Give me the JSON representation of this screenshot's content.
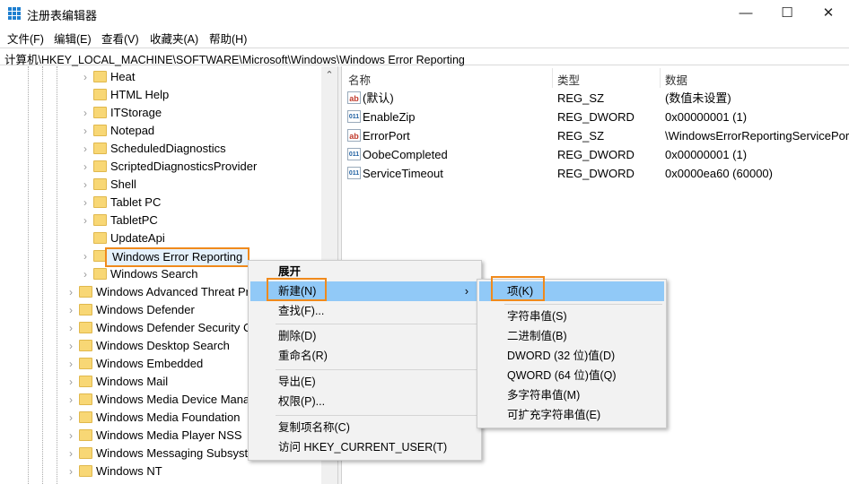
{
  "window": {
    "title": "注册表编辑器",
    "minimize": "—",
    "maximize": "☐",
    "close": "✕"
  },
  "menubar": [
    "文件(F)",
    "编辑(E)",
    "查看(V)",
    "收藏夹(A)",
    "帮助(H)"
  ],
  "address": "计算机\\HKEY_LOCAL_MACHINE\\SOFTWARE\\Microsoft\\Windows\\Windows Error Reporting",
  "tree": [
    {
      "label": "Heat",
      "level": 1,
      "arrow": true
    },
    {
      "label": "HTML Help",
      "level": 1,
      "arrow": false
    },
    {
      "label": "ITStorage",
      "level": 1,
      "arrow": true
    },
    {
      "label": "Notepad",
      "level": 1,
      "arrow": true
    },
    {
      "label": "ScheduledDiagnostics",
      "level": 1,
      "arrow": true
    },
    {
      "label": "ScriptedDiagnosticsProvider",
      "level": 1,
      "arrow": true
    },
    {
      "label": "Shell",
      "level": 1,
      "arrow": true
    },
    {
      "label": "Tablet PC",
      "level": 1,
      "arrow": true
    },
    {
      "label": "TabletPC",
      "level": 1,
      "arrow": true
    },
    {
      "label": "UpdateApi",
      "level": 1,
      "arrow": false
    },
    {
      "label": "Windows Error Reporting",
      "level": 1,
      "arrow": true,
      "selected": true
    },
    {
      "label": "Windows Search",
      "level": 1,
      "arrow": true
    },
    {
      "label": "Windows Advanced Threat Protection",
      "level": 0,
      "arrow": true
    },
    {
      "label": "Windows Defender",
      "level": 0,
      "arrow": true
    },
    {
      "label": "Windows Defender Security Center",
      "level": 0,
      "arrow": true
    },
    {
      "label": "Windows Desktop Search",
      "level": 0,
      "arrow": true
    },
    {
      "label": "Windows Embedded",
      "level": 0,
      "arrow": true
    },
    {
      "label": "Windows Mail",
      "level": 0,
      "arrow": true
    },
    {
      "label": "Windows Media Device Manager",
      "level": 0,
      "arrow": true
    },
    {
      "label": "Windows Media Foundation",
      "level": 0,
      "arrow": true
    },
    {
      "label": "Windows Media Player NSS",
      "level": 0,
      "arrow": true
    },
    {
      "label": "Windows Messaging Subsystem",
      "level": 0,
      "arrow": true
    },
    {
      "label": "Windows NT",
      "level": 0,
      "arrow": true
    }
  ],
  "columns": {
    "name": "名称",
    "type": "类型",
    "data": "数据"
  },
  "values": [
    {
      "icon": "ab",
      "name": "(默认)",
      "type": "REG_SZ",
      "data": "(数值未设置)"
    },
    {
      "icon": "011",
      "name": "EnableZip",
      "type": "REG_DWORD",
      "data": "0x00000001 (1)"
    },
    {
      "icon": "ab",
      "name": "ErrorPort",
      "type": "REG_SZ",
      "data": "\\WindowsErrorReportingServicePort"
    },
    {
      "icon": "011",
      "name": "OobeCompleted",
      "type": "REG_DWORD",
      "data": "0x00000001 (1)"
    },
    {
      "icon": "011",
      "name": "ServiceTimeout",
      "type": "REG_DWORD",
      "data": "0x0000ea60 (60000)"
    }
  ],
  "context_menu": {
    "expand": "展开",
    "new": "新建(N)",
    "find": "查找(F)...",
    "delete": "删除(D)",
    "rename": "重命名(R)",
    "export": "导出(E)",
    "permissions": "权限(P)...",
    "copy_name": "复制项名称(C)",
    "visit": "访问 HKEY_CURRENT_USER(T)",
    "submenu_arrow": "›"
  },
  "submenu": {
    "key": "项(K)",
    "string": "字符串值(S)",
    "binary": "二进制值(B)",
    "dword": "DWORD (32 位)值(D)",
    "qword": "QWORD (64 位)值(Q)",
    "multi": "多字符串值(M)",
    "expand": "可扩充字符串值(E)"
  },
  "scroll_up": "⌃"
}
